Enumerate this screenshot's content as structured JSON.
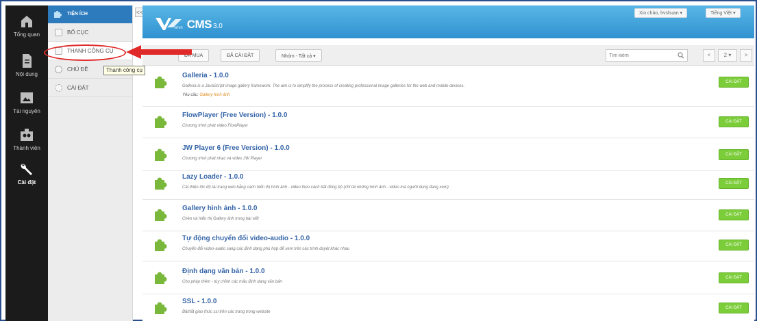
{
  "colors": {
    "accent": "#2d7bbd",
    "install": "#7ccd3a",
    "annotation": "#e02a2a",
    "rail": "#1b1b1b"
  },
  "rail": [
    {
      "label": "Tổng quan",
      "icon": "home-icon"
    },
    {
      "label": "Nội dung",
      "icon": "document-icon"
    },
    {
      "label": "Tài nguyên",
      "icon": "image-icon"
    },
    {
      "label": "Thành viên",
      "icon": "users-icon"
    },
    {
      "label": "Cài đặt",
      "icon": "wrench-icon"
    }
  ],
  "subnav": {
    "header": "TIỆN ÍCH",
    "items": [
      {
        "label": "BỐ CỤC",
        "icon": "layout-icon"
      },
      {
        "label": "THANH CÔNG CỤ",
        "icon": "toolbar-icon"
      },
      {
        "label": "CHỦ ĐỀ",
        "icon": "theme-icon"
      },
      {
        "label": "CÀI ĐẶT",
        "icon": "gear-icon"
      }
    ],
    "collapse": "<<"
  },
  "tooltip": "Thanh công cụ",
  "brand": {
    "sub": "vnvn",
    "name": "CMS",
    "version": "3.0"
  },
  "header": {
    "greeting": "Xin chào, hvshuan ▾",
    "language": "Tiếng Việt ▾"
  },
  "toolbar": {
    "purchased": "ĐÃ MUA",
    "installed": "ĐÃ CÀI ĐẶT",
    "filter": "Nhóm - Tất cả ▾",
    "search_placeholder": "Tìm kiếm",
    "prev": "<",
    "page": "2 ▾",
    "next": ">"
  },
  "plugins": [
    {
      "name": "Galleria - 1.0.0",
      "desc": "Galleria is a JavaScript image gallery framework. The aim is to simplify the process of creating professional image galleries for the web and mobile devices.",
      "req_label": "Yêu cầu:",
      "req_link": "Gallery hình ảnh",
      "button": "CÀI ĐẶT"
    },
    {
      "name": "FlowPlayer (Free Version) - 1.0.0",
      "desc": "Chương trình phát video FlowPlayer",
      "button": "CÀI ĐẶT"
    },
    {
      "name": "JW Player 6 (Free Version) - 1.0.0",
      "desc": "Chương trình phát nhạc và video JW Player",
      "button": "CÀI ĐẶT"
    },
    {
      "name": "Lazy Loader - 1.0.0",
      "desc": "Cải thiện tốc độ tải trang web bằng cách hiển thị hình ảnh - video theo cách bất đồng bộ (chỉ tải những hình ảnh - video mà người dùng đang xem)",
      "button": "CÀI ĐẶT"
    },
    {
      "name": "Gallery hình ảnh - 1.0.0",
      "desc": "Chèn và hiển thị Gallery ảnh trong bài viết",
      "button": "CÀI ĐẶT"
    },
    {
      "name": "Tự động chuyển đổi video-audio - 1.0.0",
      "desc": "Chuyển đổi video-audio sang các định dạng phù hợp để xem trên các trình duyệt khác nhau",
      "button": "CÀI ĐẶT"
    },
    {
      "name": "Định dạng văn bản - 1.0.0",
      "desc": "Cho phép thêm - tùy chỉnh các mẫu định dạng văn bản",
      "button": "CÀI ĐẶT"
    },
    {
      "name": "SSL - 1.0.0",
      "desc": "Bật/tắt giao thức ssl trên các trang trong website",
      "button": "CÀI ĐẶT"
    }
  ]
}
